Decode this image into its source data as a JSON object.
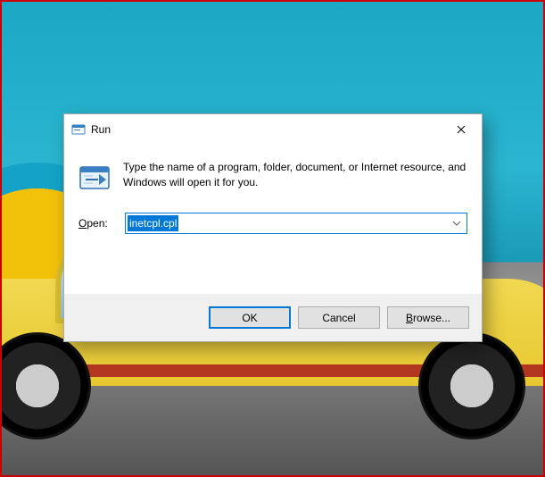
{
  "dialog": {
    "title": "Run",
    "description": "Type the name of a program, folder, document, or Internet resource, and Windows will open it for you.",
    "open_label": "Open:",
    "input_value": "inetcpl.cpl",
    "buttons": {
      "ok": "OK",
      "cancel": "Cancel",
      "browse": "Browse..."
    }
  },
  "icons": {
    "run_small": "run-icon",
    "run_large": "run-icon-large",
    "close": "close-icon",
    "dropdown": "chevron-down-icon"
  },
  "colors": {
    "accent": "#0078d7",
    "titlebar_bg": "#ffffff",
    "button_panel_bg": "#f0f0f0"
  }
}
